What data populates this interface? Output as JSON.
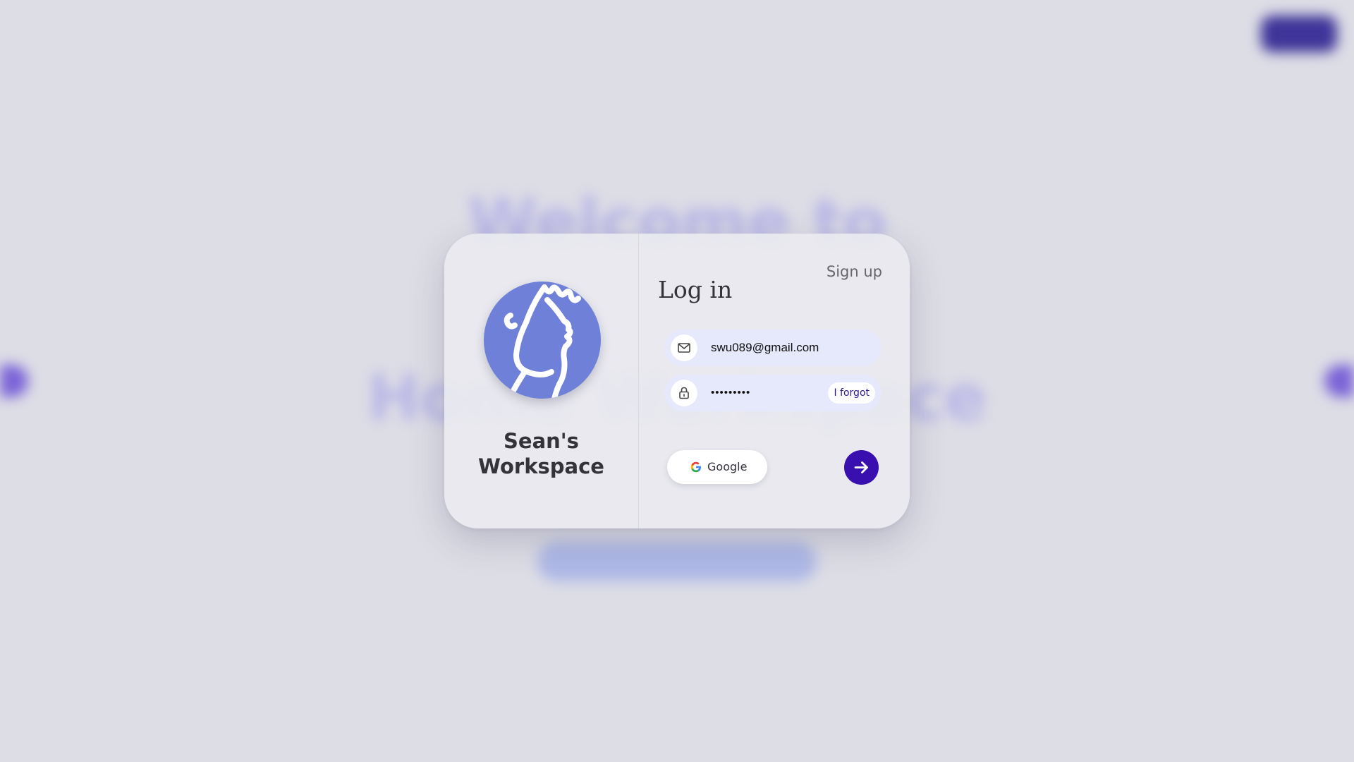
{
  "background": {
    "headline_line1": "Welcome to",
    "headline_line2": "Home Workspace"
  },
  "workspace": {
    "name": "Sean's\nWorkspace",
    "avatar_icon": "cartoon-face-icon",
    "avatar_color": "#6f80d9"
  },
  "login": {
    "title": "Log in",
    "signup_label": "Sign up",
    "email_value": "swu089@gmail.com",
    "email_icon": "mail-icon",
    "password_value": "•••••••••",
    "password_icon": "lock-icon",
    "forgot_label": "I forgot",
    "google_label": "Google",
    "google_icon": "google-g-icon",
    "submit_icon": "arrow-right-icon",
    "accent_color": "#3a0fb0"
  }
}
